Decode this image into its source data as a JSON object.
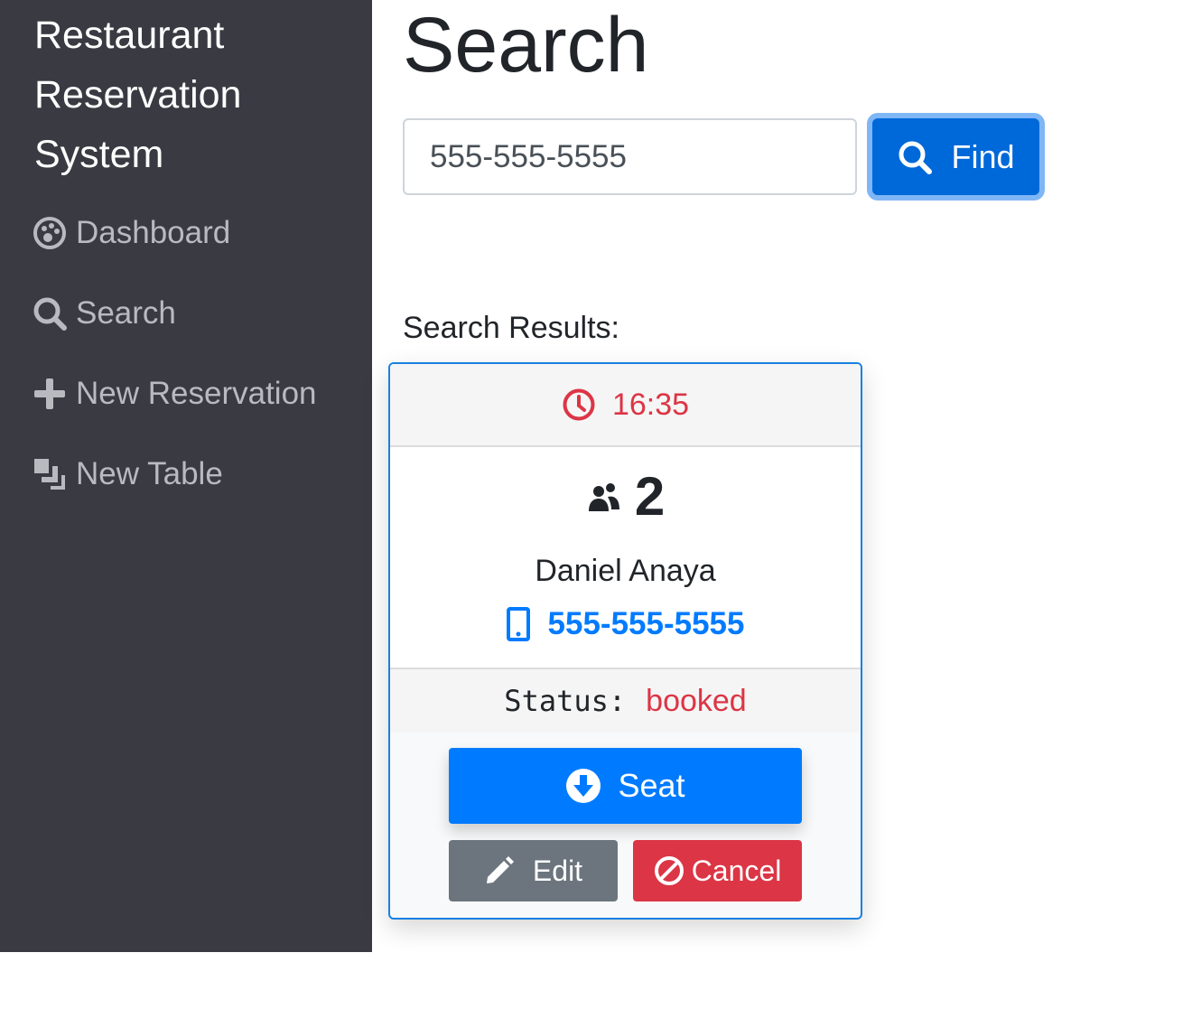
{
  "sidebar": {
    "brand": [
      "Restaurant",
      "Reservation",
      "System"
    ],
    "items": [
      {
        "label": "Dashboard",
        "icon": "dashboard-icon"
      },
      {
        "label": "Search",
        "icon": "search-icon"
      },
      {
        "label": "New Reservation",
        "icon": "plus-icon"
      },
      {
        "label": "New Table",
        "icon": "layers-icon"
      }
    ]
  },
  "page": {
    "title": "Search"
  },
  "search": {
    "value": "555-555-5555",
    "button_label": "Find"
  },
  "results": {
    "label": "Search Results:",
    "reservation": {
      "time": "16:35",
      "party_size": "2",
      "name": "Daniel Anaya",
      "phone": "555-555-5555",
      "status_label": "Status:",
      "status": "booked",
      "seat_label": "Seat",
      "edit_label": "Edit",
      "cancel_label": "Cancel"
    }
  },
  "colors": {
    "sidebar_bg": "#393a42",
    "primary": "#007bff",
    "danger": "#dc3545",
    "secondary": "#6c757d"
  }
}
